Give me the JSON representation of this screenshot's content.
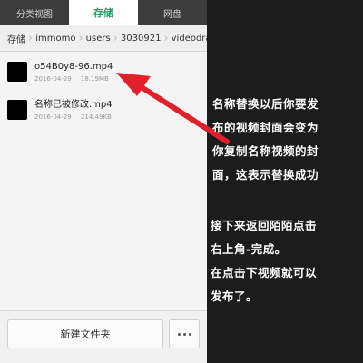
{
  "tabs": [
    {
      "label": "分类视图"
    },
    {
      "label": "存储"
    },
    {
      "label": "网盘"
    }
  ],
  "breadcrumb": [
    "存储",
    "immomo",
    "users",
    "3030921",
    "videodraft"
  ],
  "files": [
    {
      "name": "o54B0y8-96.mp4",
      "date": "2016-04-29",
      "size": "18.19MB"
    },
    {
      "name": "名称已被修改.mp4",
      "date": "2016-04-29",
      "size": "214.49KB"
    }
  ],
  "bottom": {
    "new_folder_label": "新建文件夹"
  },
  "annotation": {
    "arrow_color": "#e0202a"
  },
  "instructions": {
    "para1": [
      "名称替换以后你要发",
      "布的视频封面会变为",
      "你复制名称视频的封",
      "面，这表示替换成功"
    ],
    "para2": [
      "接下来返回陌陌点击",
      "右上角-完成。",
      "在点击下视频就可以",
      "发布了。"
    ]
  }
}
